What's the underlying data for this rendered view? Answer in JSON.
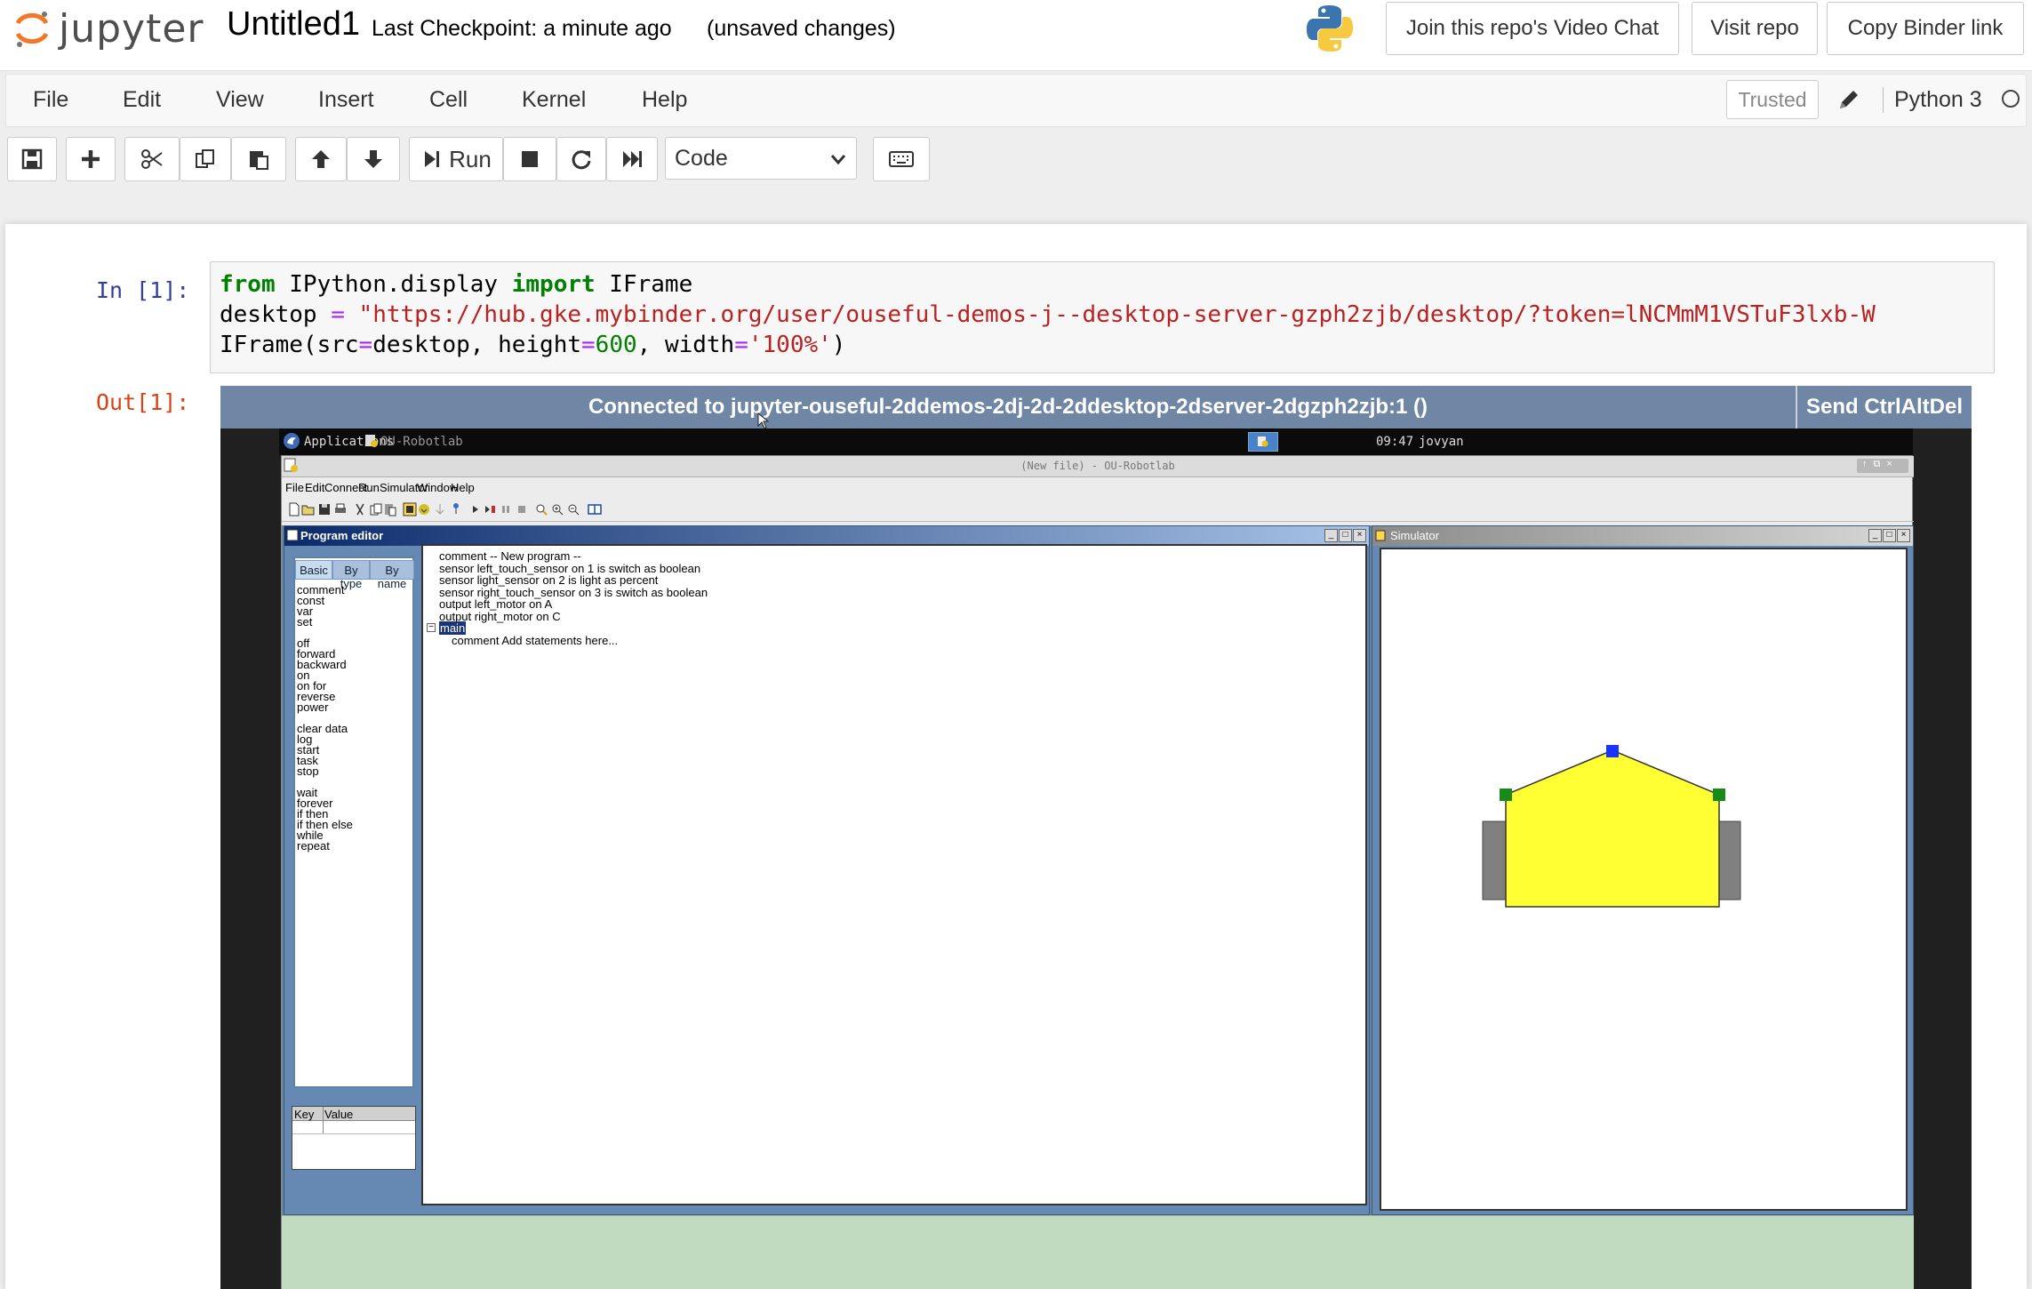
{
  "header": {
    "logo_text": "jupyter",
    "notebook_title": "Untitled1",
    "checkpoint": "Last Checkpoint: a minute ago",
    "unsaved": "(unsaved changes)",
    "buttons": [
      "Join this repo's Video Chat",
      "Visit repo",
      "Copy Binder link"
    ]
  },
  "menubar": {
    "items": [
      "File",
      "Edit",
      "View",
      "Insert",
      "Cell",
      "Kernel",
      "Help"
    ],
    "trusted": "Trusted",
    "kernel": "Python 3"
  },
  "toolbar": {
    "run_label": "Run",
    "cell_type": "Code",
    "icons": [
      "save-icon",
      "plus-icon",
      "cut-icon",
      "copy-icon",
      "paste-icon",
      "arrow-up-icon",
      "arrow-down-icon",
      "run-icon",
      "stop-icon",
      "restart-icon",
      "fast-forward-icon",
      "keyboard-icon"
    ]
  },
  "cell": {
    "in_prompt": "In [1]:",
    "out_prompt": "Out[1]:",
    "code": {
      "l1_kw1": "from",
      "l1_mod": " IPython.display ",
      "l1_kw2": "import",
      "l1_name": " IFrame",
      "l2_var": "desktop ",
      "l2_op": "=",
      "l2_str": " \"https://hub.gke.mybinder.org/user/ouseful-demos-j--desktop-server-gzph2zjb/desktop/?token=lNCMmM1VSTuF3lxb-W",
      "l3_a": "IFrame(src",
      "l3_op1": "=",
      "l3_b": "desktop, height",
      "l3_op2": "=",
      "l3_num": "600",
      "l3_c": ", width",
      "l3_op3": "=",
      "l3_str": "'100%'",
      "l3_d": ")"
    }
  },
  "novnc": {
    "status": "Connected to jupyter-ouseful-2ddemos-2dj-2d-2ddesktop-2dserver-2dgzph2zjb:1 ()",
    "ctrlaltdel": "Send CtrlAltDel"
  },
  "desktop_panel": {
    "applications": "Applications",
    "task": "OU-Robotlab",
    "clock": "09:47",
    "user": "jovyan"
  },
  "robotlab": {
    "title": "(New file) - OU-Robotlab",
    "menu": [
      "File",
      "Edit",
      "Connect",
      "Run",
      "Simulator",
      "Window",
      "Help"
    ],
    "program_editor_title": "Program editor",
    "simulator_title": "Simulator",
    "tabs": [
      "Basic",
      "By type",
      "By name"
    ],
    "palette_groups": [
      [
        "comment",
        "const",
        "var",
        "set"
      ],
      [
        "off",
        "forward",
        "backward",
        "on",
        "on for",
        "reverse",
        "power"
      ],
      [
        "clear data",
        "log",
        "start",
        "task",
        "stop"
      ],
      [
        "wait",
        "forever",
        "if then",
        "if then else",
        "while",
        "repeat"
      ]
    ],
    "kv_headers": [
      "Key",
      "Value"
    ],
    "program_lines": [
      "comment -- New program --",
      "sensor left_touch_sensor on 1 is switch as boolean",
      "sensor light_sensor on 2 is light as percent",
      "sensor right_touch_sensor on 3 is switch as boolean",
      "output left_motor on A",
      "output right_motor on C"
    ],
    "main_label": "main",
    "main_child": "comment Add statements here..."
  },
  "colors": {
    "robot_body": "#ffff33",
    "robot_front_sensor": "#1a33ff",
    "robot_touch_sensors": "#178a17",
    "robot_wheels": "#808080"
  }
}
